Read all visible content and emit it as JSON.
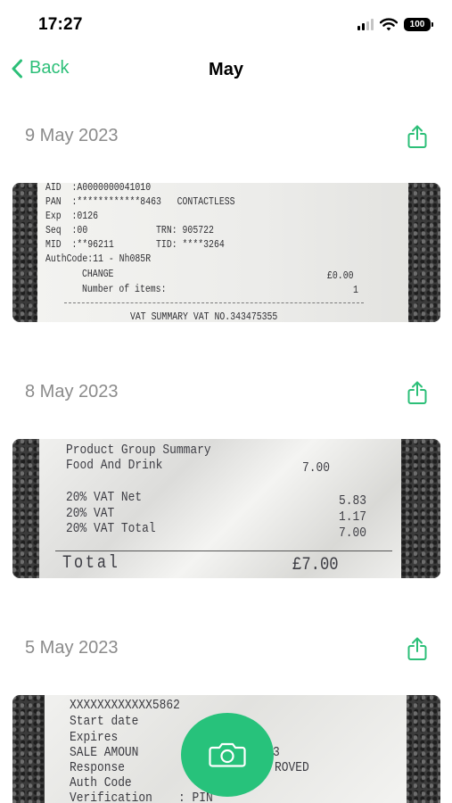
{
  "status": {
    "time": "17:27",
    "battery": "100"
  },
  "nav": {
    "back_label": "Back",
    "title": "May"
  },
  "colors": {
    "accent": "#2cbf78",
    "date_text": "#8b8b8b",
    "camera_button": "#27c27b"
  },
  "entries": [
    {
      "date": "9 May 2023",
      "receipt_lines": [
        "AID  :A0000000041010",
        "PAN  :************8463   CONTACTLESS",
        "Exp  :0126",
        "Seq  :00             TRN: 905722",
        "MID  :**96211        TID: ****3264",
        "AuthCode:11 - Nh085R",
        "CHANGE",
        "£0.00",
        "Number of items:",
        "1",
        "VAT SUMMARY VAT NO.343475355"
      ]
    },
    {
      "date": "8 May 2023",
      "receipt_lines": [
        "Product Group Summary",
        "Food And Drink",
        "7.00",
        "20% VAT Net",
        "5.83",
        "20% VAT",
        "1.17",
        "20% VAT Total",
        "7.00",
        "Total",
        "£7.00"
      ]
    },
    {
      "date": "5 May 2023",
      "receipt_lines": [
        "XXXXXXXXXXXX5862",
        "Start date",
        "Expires",
        "SALE AMOUN",
        "3",
        "Response",
        "ROVED",
        "Auth Code",
        "Verification",
        ": PIN"
      ]
    }
  ],
  "icons": {
    "back": "chevron-left-icon",
    "share": "share-icon",
    "camera": "camera-icon",
    "wifi": "wifi-icon",
    "signal": "cellular-signal-icon",
    "battery": "battery-icon"
  }
}
